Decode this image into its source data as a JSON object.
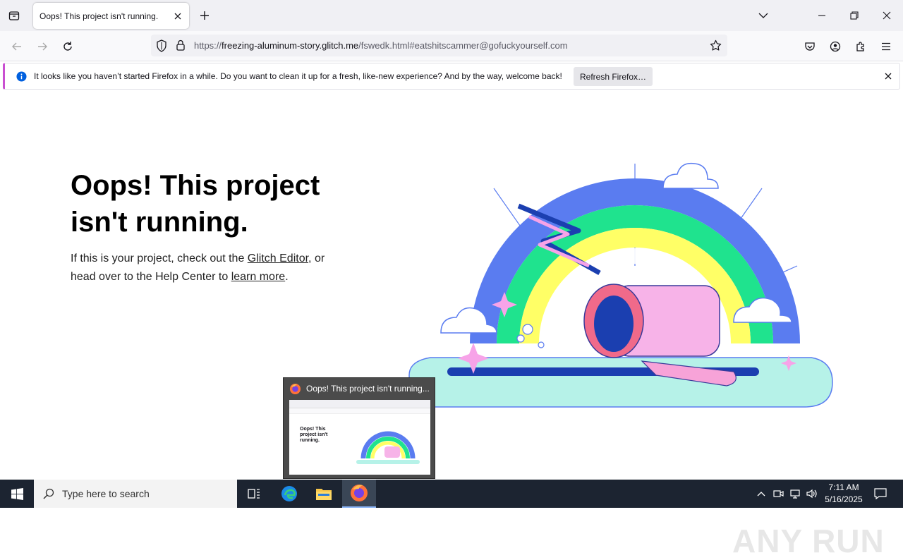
{
  "tab": {
    "title": "Oops! This project isn't running."
  },
  "url": {
    "prefix": "https://",
    "host": "freezing-aluminum-story.glitch.me",
    "path": "/fswedk.html#eatshitscammer@gofuckyourself.com"
  },
  "notification": {
    "text": "It looks like you haven’t started Firefox in a while. Do you want to clean it up for a fresh, like-new experience? And by the way, welcome back!",
    "button_label": "Refresh Firefox…"
  },
  "page": {
    "headline": "Oops! This project isn't running.",
    "para_part1": "If this is your project, check out the ",
    "link_editor": "Glitch Editor",
    "para_part2": ", or head over to the Help Center to ",
    "link_learn": "learn more",
    "para_part3": "."
  },
  "thumbnail": {
    "title": "Oops! This project isn't running...",
    "preview_headline": "Oops! This project isn't running."
  },
  "watermark": "ANY RUN",
  "taskbar": {
    "search_placeholder": "Type here to search",
    "time": "7:11 AM",
    "date": "5/16/2025"
  },
  "colors": {
    "accent": "#c94fd1",
    "taskbar": "#1c2431",
    "tabbar": "#f0f0f4"
  },
  "icons": [
    "tab-list-icon",
    "close-icon",
    "plus-icon",
    "chevron-down-icon",
    "minimize-icon",
    "restore-icon",
    "back-icon",
    "forward-icon",
    "reload-icon",
    "shield-icon",
    "lock-icon",
    "star-icon",
    "pocket-icon",
    "account-icon",
    "extensions-icon",
    "menu-icon",
    "info-icon",
    "windows-logo-icon",
    "search-icon",
    "task-view-icon",
    "edge-icon",
    "file-explorer-icon",
    "firefox-icon",
    "chevron-up-icon",
    "network-icon",
    "volume-icon",
    "notification-icon"
  ]
}
